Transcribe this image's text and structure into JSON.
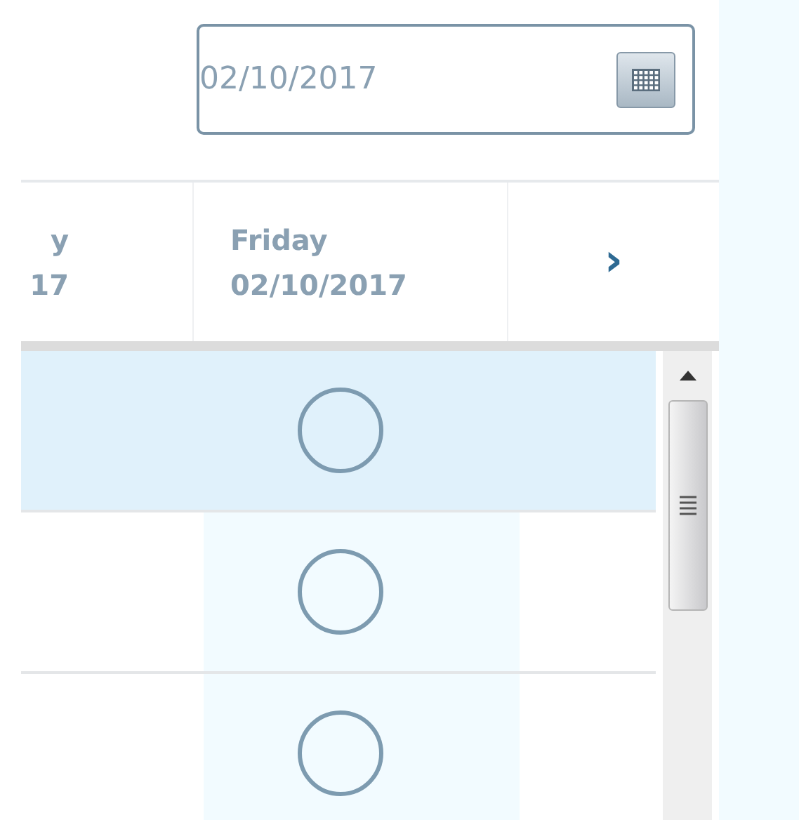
{
  "date_field": {
    "value": "02/10/2017"
  },
  "columns": [
    {
      "day": "y",
      "date": "17"
    },
    {
      "day": "Friday",
      "date": "02/10/2017"
    }
  ],
  "next_button": {
    "label": "›"
  },
  "rows": [
    {
      "highlighted": true,
      "checked": false
    },
    {
      "highlighted": false,
      "checked": false
    },
    {
      "highlighted": false,
      "checked": false
    }
  ]
}
